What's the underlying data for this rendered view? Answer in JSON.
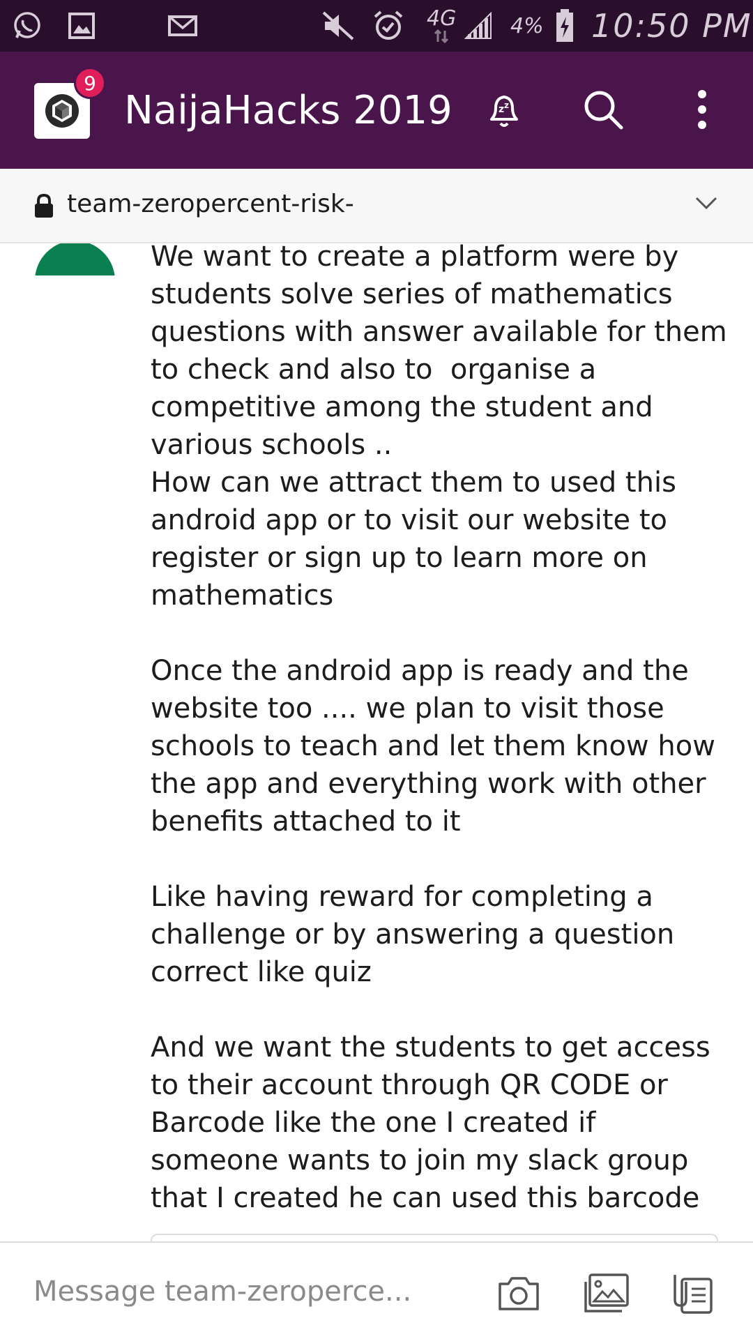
{
  "status_bar": {
    "network": "4G",
    "battery": "4%",
    "time": "10:50 PM",
    "icons": [
      "whatsapp-icon",
      "gallery-icon",
      "mail-icon",
      "mute-icon",
      "alarm-icon",
      "data-arrows-icon",
      "signal-icon",
      "battery-charging-icon"
    ]
  },
  "header": {
    "workspace_name": "NaijaHacks 2019",
    "badge_count": "9",
    "icons": [
      "workspace-logo-icon",
      "snooze-bell-icon",
      "search-icon",
      "more-vert-icon"
    ]
  },
  "channel": {
    "name": "team-zeropercent-risk-",
    "private": true
  },
  "message": {
    "text": "We want to create a platform were by students solve series of mathematics questions with answer available for them to check and also to  organise a competitive among the student and various schools ..\nHow can we attract them to used this android app or to visit our website to register or sign up to learn more on mathematics\n\nOnce the android app is ready and the website too .... we plan to visit those schools to teach and let them know how the app and everything work with other benefits attached to it\n\nLike having reward for completing a challenge or by answering a question correct like quiz\n\nAnd we want the students to get access to their account through QR CODE or Barcode like the one I created if someone wants to join my slack group that I created he can used this barcode",
    "avatar_color": "#0a8050"
  },
  "composer": {
    "placeholder": "Message team-zeroperce...",
    "icons": [
      "camera-icon",
      "image-icon",
      "files-icon"
    ]
  },
  "colors": {
    "status_bar": "#2a0f2c",
    "header": "#4a154b",
    "badge": "#e01e5a"
  }
}
